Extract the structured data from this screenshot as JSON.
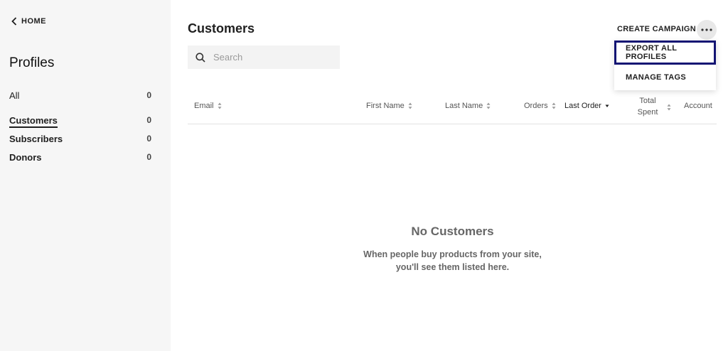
{
  "sidebar": {
    "home_label": "HOME",
    "title": "Profiles",
    "items": [
      {
        "label": "All",
        "count": "0"
      },
      {
        "label": "Customers",
        "count": "0"
      },
      {
        "label": "Subscribers",
        "count": "0"
      },
      {
        "label": "Donors",
        "count": "0"
      }
    ]
  },
  "header": {
    "title": "Customers",
    "create_campaign_label": "CREATE CAMPAIGN"
  },
  "search": {
    "placeholder": "Search",
    "value": ""
  },
  "menu": {
    "items": [
      {
        "label": "EXPORT ALL PROFILES"
      },
      {
        "label": "MANAGE TAGS"
      }
    ]
  },
  "table": {
    "columns": {
      "email": "Email",
      "first_name": "First Name",
      "last_name": "Last Name",
      "orders": "Orders",
      "last_order": "Last Order",
      "total_spent_1": "Total",
      "total_spent_2": "Spent",
      "account": "Account"
    }
  },
  "empty_state": {
    "title": "No Customers",
    "description": "When people buy products from your site, you'll see them listed here."
  },
  "colors": {
    "sidebar_bg": "#f6f6f6",
    "highlight_border": "#131473"
  }
}
